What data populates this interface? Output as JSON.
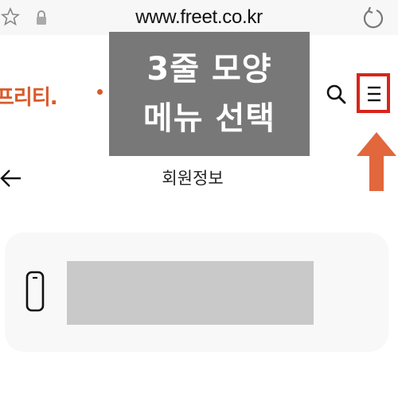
{
  "browser": {
    "url": "www.freet.co.kr",
    "icons": {
      "bookmark": "star-icon",
      "secure": "lock-icon",
      "reload": "reload-icon"
    }
  },
  "site": {
    "logo_text": "프리티.",
    "brand_color": "#d95a2b",
    "icons": {
      "search": "search-icon",
      "menu": "hamburger-menu-icon"
    }
  },
  "overlay_caption": {
    "line1": "3줄 모양",
    "line2": "메뉴 선택",
    "highlight_color": "#d7251b",
    "arrow_color": "#e2673c"
  },
  "page": {
    "title": "회원정보",
    "icons": {
      "back": "back-arrow-icon",
      "phone": "phone-icon"
    }
  }
}
